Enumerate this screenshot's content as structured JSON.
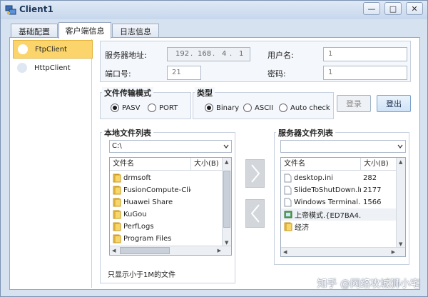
{
  "window": {
    "title": "Client1",
    "minimize": "—",
    "maximize": "□",
    "close": "✕"
  },
  "tabs": [
    {
      "label": "基础配置"
    },
    {
      "label": "客户端信息"
    },
    {
      "label": "日志信息"
    }
  ],
  "client_list": [
    {
      "label": "FtpClient",
      "selected": true
    },
    {
      "label": "HttpClient",
      "selected": false
    }
  ],
  "server": {
    "address_label": "服务器地址:",
    "ip": [
      "192",
      "168",
      "4",
      "1"
    ],
    "port_label": "端口号:",
    "port": "21",
    "user_label": "用户名:",
    "user": "1",
    "password_label": "密码:",
    "password": "1"
  },
  "transfer_mode": {
    "title": "文件传输模式",
    "options": [
      "PASV",
      "PORT"
    ],
    "selected": "PASV"
  },
  "type": {
    "title": "类型",
    "options": [
      "Binary",
      "ASCII",
      "Auto check"
    ],
    "selected": "Binary"
  },
  "buttons": {
    "login": "登录",
    "logout": "登出"
  },
  "local": {
    "title": "本地文件列表",
    "path": "C:\\",
    "headers": [
      "文件名",
      "大小(B)"
    ],
    "files": [
      {
        "name": "drmsoft",
        "size": ""
      },
      {
        "name": "FusionCompute-Clie...",
        "size": ""
      },
      {
        "name": "Huawei Share",
        "size": ""
      },
      {
        "name": "KuGou",
        "size": ""
      },
      {
        "name": "PerfLogs",
        "size": ""
      },
      {
        "name": "Program Files",
        "size": ""
      }
    ],
    "note": "只显示小于1M的文件"
  },
  "remote": {
    "title": "服务器文件列表",
    "path": "",
    "headers": [
      "文件名",
      "大小(B)"
    ],
    "files": [
      {
        "name": "desktop.ini",
        "size": "282",
        "kind": "file"
      },
      {
        "name": "SlideToShutDown.lnk",
        "size": "2177",
        "kind": "file"
      },
      {
        "name": "Windows Terminal.lnk",
        "size": "1566",
        "kind": "file"
      },
      {
        "name": "上帝模式.{ED7BA4...",
        "size": "",
        "kind": "special"
      },
      {
        "name": "经济",
        "size": "",
        "kind": "folder"
      }
    ]
  },
  "transfer_buttons": {
    "upload": "upload-arrow-icon",
    "download": "download-arrow-icon"
  },
  "watermark": "知乎 @网络攻城狮小宅",
  "colors": {
    "selection": "#fbd56c",
    "window_bg": "#d6e2f0",
    "folder": "#f2c64a"
  }
}
